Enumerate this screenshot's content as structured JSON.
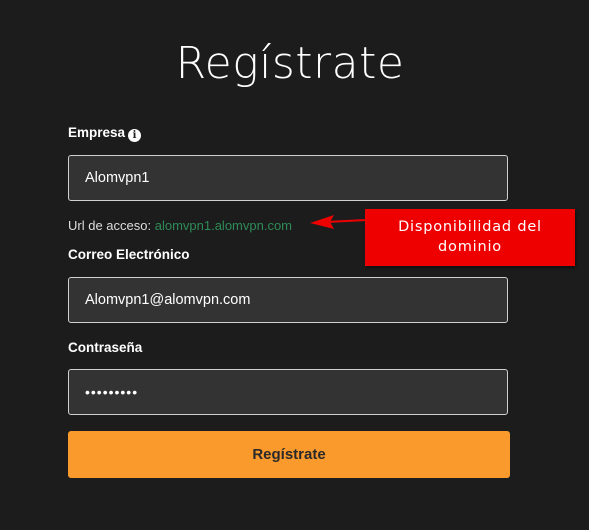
{
  "page": {
    "title": "Regístrate"
  },
  "form": {
    "company": {
      "label": "Empresa",
      "info_icon": "info-icon",
      "value": "Alomvpn1"
    },
    "access_url": {
      "label": "Url de acceso:",
      "value": "alomvpn1.alomvpn.com"
    },
    "email": {
      "label": "Correo Electrónico",
      "value": "Alomvpn1@alomvpn.com"
    },
    "password": {
      "label": "Contraseña",
      "value": "•••••••••"
    },
    "submit_label": "Regístrate"
  },
  "annotation": {
    "line1": "Disponibilidad del",
    "line2": "dominio"
  },
  "colors": {
    "background": "#1c1c1c",
    "input_background": "#333333",
    "accent_button": "#fb9a2c",
    "url_value": "#2e8b57",
    "callout": "#ee0000"
  }
}
